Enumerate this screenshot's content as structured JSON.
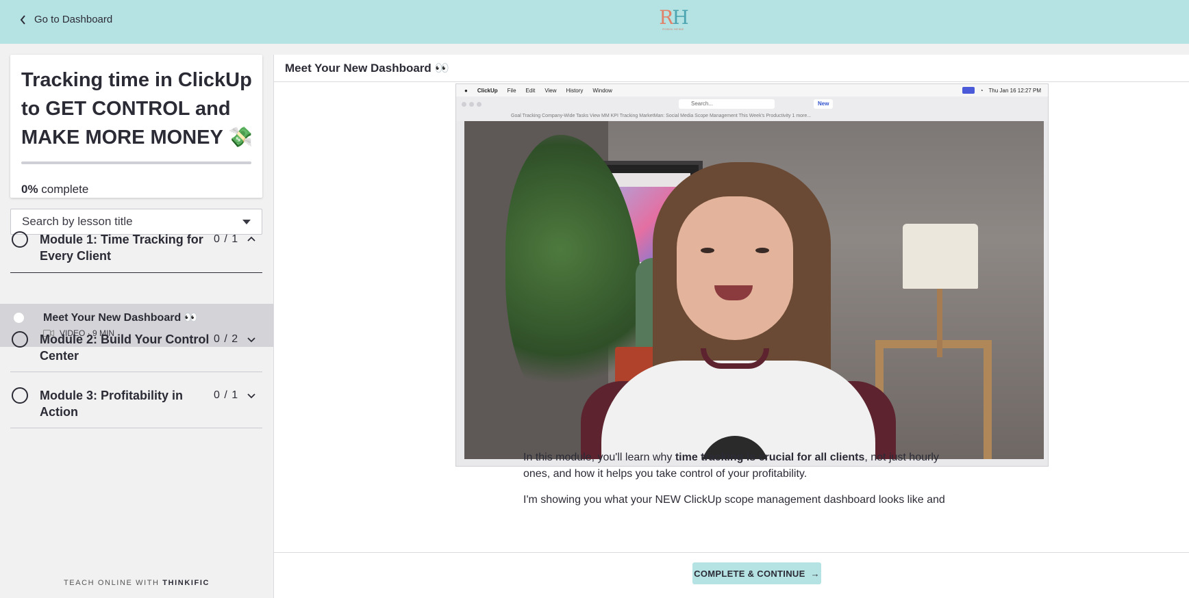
{
  "topbar": {
    "back_label": "Go to Dashboard",
    "logo_text": "RH",
    "logo_sub": "ROBIN HEINE"
  },
  "course": {
    "title": "Tracking time in ClickUp to GET CONTROL and MAKE MORE MONEY 💸",
    "progress_percent": 0,
    "progress_value": "0%",
    "progress_suffix": " complete"
  },
  "search": {
    "placeholder": "Search by lesson title"
  },
  "modules": [
    {
      "title": "Module 1: Time Tracking for Every Client",
      "count": "0 / 1",
      "expanded": true
    },
    {
      "title": "Module 2: Build Your Control Center",
      "count": "0 / 2",
      "expanded": false
    },
    {
      "title": "Module 3: Profitability in Action",
      "count": "0 / 1",
      "expanded": false
    }
  ],
  "current_lesson": {
    "title": "Meet Your New Dashboard 👀",
    "meta": "VIDEO · 9 MIN"
  },
  "footer": {
    "prefix": "TEACH ONLINE WITH ",
    "brand": "THINKIFIC"
  },
  "main": {
    "header_title": "Meet Your New Dashboard 👀",
    "paragraph1_pre": "In this module, you'll learn why ",
    "paragraph1_bold": "time tracking is crucial for all clients",
    "paragraph1_post": ", not just hourly ones, and how it helps you take control of your profitability.",
    "paragraph2": "I'm showing you what your NEW ClickUp scope management dashboard looks like and"
  },
  "video": {
    "menubar_app": "ClickUp",
    "menubar_items": [
      "File",
      "Edit",
      "View",
      "History",
      "Window"
    ],
    "menubar_clock": "Thu Jan 16  12:27 PM",
    "browser_search": "Search...",
    "browser_new": "New",
    "bookmarks": "Goal Tracking    Company-Wide Tasks View    MM KPI Tracking    MarketMan: Social Media    Scope Management    This Week's Productivity    1 more..."
  },
  "actions": {
    "complete_label": "COMPLETE & CONTINUE",
    "complete_arrow": "→"
  },
  "colors": {
    "accent": "#b5e3e3",
    "text": "#2b2b36"
  }
}
